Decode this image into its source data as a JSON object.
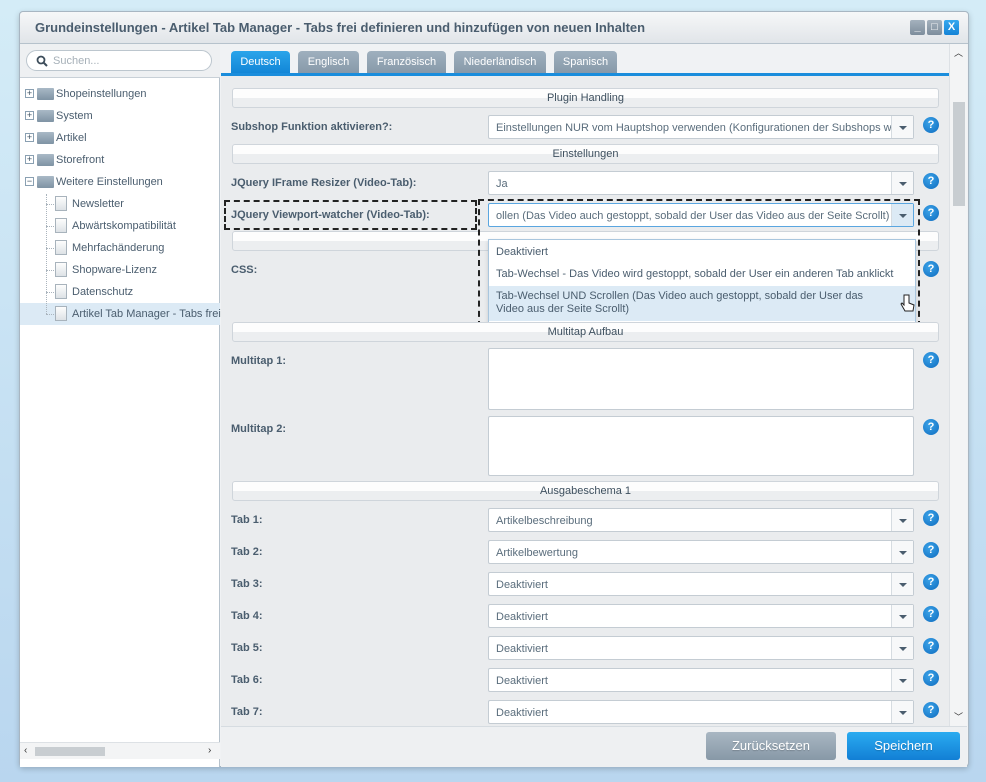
{
  "window": {
    "title": "Grundeinstellungen - Artikel Tab Manager - Tabs frei definieren und hinzufügen von neuen Inhalten",
    "buttons": {
      "minimize": "_",
      "maximize": "□",
      "close": "X"
    }
  },
  "sidebar": {
    "search_placeholder": "Suchen...",
    "items": [
      {
        "label": "Shopeinstellungen",
        "type": "folder"
      },
      {
        "label": "System",
        "type": "folder"
      },
      {
        "label": "Artikel",
        "type": "folder"
      },
      {
        "label": "Storefront",
        "type": "folder"
      },
      {
        "label": "Weitere Einstellungen",
        "type": "folder-open"
      },
      {
        "label": "Newsletter",
        "type": "doc"
      },
      {
        "label": "Abwärtskompatibilität",
        "type": "doc"
      },
      {
        "label": "Mehrfachänderung",
        "type": "doc"
      },
      {
        "label": "Shopware-Lizenz",
        "type": "doc"
      },
      {
        "label": "Datenschutz",
        "type": "doc"
      },
      {
        "label": "Artikel Tab Manager - Tabs frei",
        "type": "doc",
        "selected": true
      }
    ]
  },
  "tabs": [
    {
      "label": "Deutsch",
      "active": true
    },
    {
      "label": "Englisch"
    },
    {
      "label": "Französisch"
    },
    {
      "label": "Niederländisch"
    },
    {
      "label": "Spanisch"
    }
  ],
  "form": {
    "sections": {
      "plugin": "Plugin Handling",
      "settings": "Einstellungen",
      "multitap": "Multitap Aufbau",
      "schema": "Ausgabeschema 1"
    },
    "subshop": {
      "label": "Subshop Funktion aktivieren?:",
      "value": "Einstellungen NUR vom Hauptshop verwenden (Konfigurationen der Subshops werden ignoriert)"
    },
    "iframe": {
      "label": "JQuery IFrame Resizer (Video-Tab):",
      "value": "Ja"
    },
    "viewport": {
      "label": "JQuery Viewport-watcher (Video-Tab):",
      "value": "ollen (Das Video auch gestoppt, sobald der User das Video aus der Seite Scrollt)",
      "options": [
        "Deaktiviert",
        "Tab-Wechsel - Das Video wird gestoppt, sobald der User ein anderen Tab anklickt",
        "Tab-Wechsel UND Scrollen (Das Video auch gestoppt, sobald der User das Video aus der Seite Scrollt)"
      ]
    },
    "css": {
      "label": "CSS:"
    },
    "multitap1": {
      "label": "Multitap 1:",
      "value": ""
    },
    "multitap2": {
      "label": "Multitap 2:",
      "value": ""
    },
    "tabsel": [
      {
        "label": "Tab 1:",
        "value": "Artikelbeschreibung"
      },
      {
        "label": "Tab 2:",
        "value": "Artikelbewertung"
      },
      {
        "label": "Tab 3:",
        "value": "Deaktiviert"
      },
      {
        "label": "Tab 4:",
        "value": "Deaktiviert"
      },
      {
        "label": "Tab 5:",
        "value": "Deaktiviert"
      },
      {
        "label": "Tab 6:",
        "value": "Deaktiviert"
      },
      {
        "label": "Tab 7:",
        "value": "Deaktiviert"
      }
    ],
    "help": "?"
  },
  "footer": {
    "reset": "Zurücksetzen",
    "save": "Speichern"
  }
}
